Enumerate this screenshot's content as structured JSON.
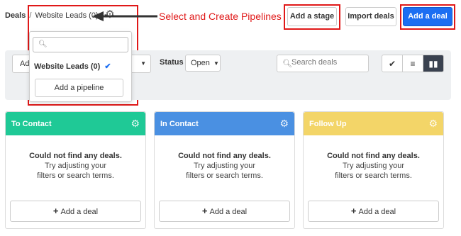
{
  "breadcrumb": {
    "root": "Deals",
    "separator": "/",
    "pipeline": "Website Leads (0)"
  },
  "callout": {
    "text": "Select and Create Pipelines"
  },
  "toolbar": {
    "add_stage": "Add a stage",
    "import_deals": "Import deals",
    "add_deal": "Add a deal"
  },
  "dropdown": {
    "search_placeholder": "",
    "selected_pipeline": "Website Leads (0)",
    "check": "✔",
    "add_pipeline": "Add a pipeline"
  },
  "filters": {
    "owner_select": "Add",
    "status_label": "Status",
    "status_value": "Open",
    "search_placeholder": "Search deals"
  },
  "views": {
    "check_icon": "✔",
    "list_icon": "≡",
    "board_icon": "▮▮"
  },
  "stages": [
    {
      "title": "To Contact",
      "color": "#1fc996"
    },
    {
      "title": "In Contact",
      "color": "#4a90e2"
    },
    {
      "title": "Follow Up",
      "color": "#f3d568"
    }
  ],
  "empty_state": {
    "title": "Could not find any deals.",
    "line1": "Try adjusting your",
    "line2": "filters or search terms."
  },
  "add_deal_label": "Add a deal",
  "colors": {
    "accent_red": "#e01818",
    "primary_blue": "#1c6ef2"
  }
}
